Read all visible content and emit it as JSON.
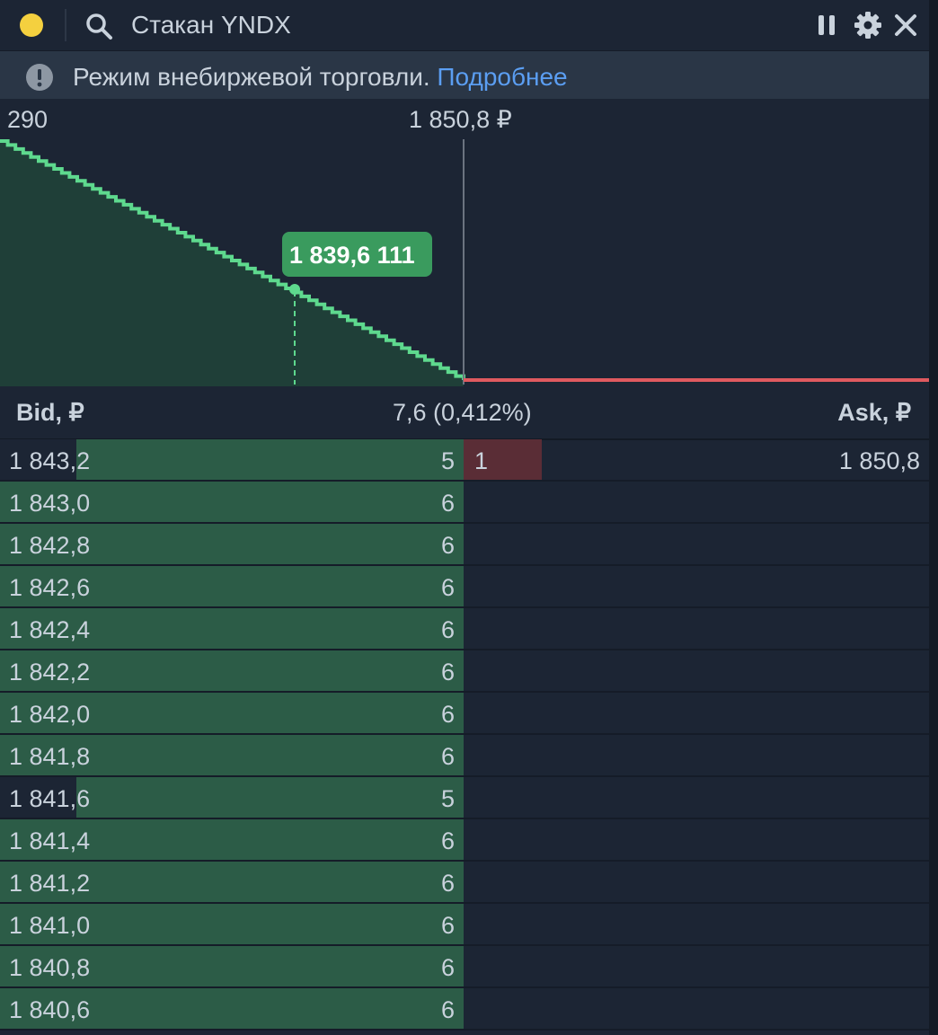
{
  "toolbar": {
    "search_value": "Стакан YNDX",
    "pause_icon": "pause-icon",
    "settings_icon": "gear-icon",
    "close_icon": "close-icon"
  },
  "banner": {
    "text": "Режим внебиржевой торговли.",
    "link": "Подробнее"
  },
  "chart": {
    "left_label": "290",
    "center_label": "1 850,8 ₽",
    "tooltip": "1 839,6 111"
  },
  "header": {
    "bid": "Bid, ₽",
    "spread": "7,6 (0,412%)",
    "ask": "Ask, ₽"
  },
  "colors": {
    "bid": "#2c5c47",
    "ask": "#5a2d36",
    "bid_line": "#5ed98e",
    "ask_line": "#e05a5f",
    "link": "#5b9ef2"
  },
  "rows": [
    {
      "bid_price": "1 843,2",
      "bid_qty": "5",
      "ask_qty": "1",
      "ask_price": "1 850,8"
    },
    {
      "bid_price": "1 843,0",
      "bid_qty": "6"
    },
    {
      "bid_price": "1 842,8",
      "bid_qty": "6"
    },
    {
      "bid_price": "1 842,6",
      "bid_qty": "6"
    },
    {
      "bid_price": "1 842,4",
      "bid_qty": "6"
    },
    {
      "bid_price": "1 842,2",
      "bid_qty": "6"
    },
    {
      "bid_price": "1 842,0",
      "bid_qty": "6"
    },
    {
      "bid_price": "1 841,8",
      "bid_qty": "6"
    },
    {
      "bid_price": "1 841,6",
      "bid_qty": "5"
    },
    {
      "bid_price": "1 841,4",
      "bid_qty": "6"
    },
    {
      "bid_price": "1 841,2",
      "bid_qty": "6"
    },
    {
      "bid_price": "1 841,0",
      "bid_qty": "6"
    },
    {
      "bid_price": "1 840,8",
      "bid_qty": "6"
    },
    {
      "bid_price": "1 840,6",
      "bid_qty": "6"
    }
  ]
}
